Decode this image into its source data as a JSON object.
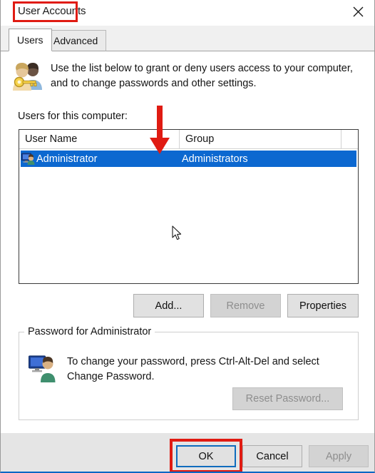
{
  "window": {
    "title": "User Accounts",
    "close_icon": "close-x-icon"
  },
  "tabs": [
    {
      "label": "Users",
      "active": true
    },
    {
      "label": "Advanced",
      "active": false
    }
  ],
  "users_tab": {
    "blurb_icon": "users-with-key-icon",
    "blurb": "Use the list below to grant or deny users access to your computer, and to change passwords and other settings.",
    "list_label": "Users for this computer:",
    "list": {
      "columns": [
        "User Name",
        "Group"
      ],
      "rows": [
        {
          "icon": "user-computer-icon",
          "user_name": "Administrator",
          "group": "Administrators",
          "selected": true
        }
      ]
    },
    "buttons": {
      "add": "Add...",
      "remove": "Remove",
      "properties": "Properties"
    },
    "password_group": {
      "title": "Password for Administrator",
      "icon": "user-monitor-icon",
      "text": "To change your password, press Ctrl-Alt-Del and select Change Password.",
      "reset_button": "Reset Password..."
    }
  },
  "footer": {
    "ok": "OK",
    "cancel": "Cancel",
    "apply": "Apply"
  },
  "annotations": {
    "title_box_color": "#e01b12",
    "arrow_color": "#e01b12",
    "ok_box_color": "#e01b12",
    "selection_color": "#0c68d0",
    "focus_border_color": "#0f6cbd"
  }
}
